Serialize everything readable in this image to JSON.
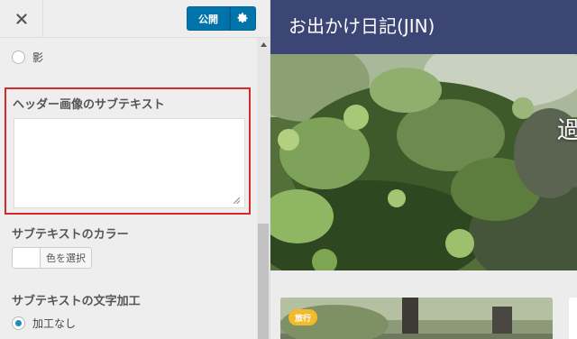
{
  "panel": {
    "publish_label": "公開",
    "shadow_option_label": "影",
    "subtext": {
      "title": "ヘッダー画像のサブテキスト",
      "value": ""
    },
    "color": {
      "title": "サブテキストのカラー",
      "button_label": "色を選択"
    },
    "decoration": {
      "title": "サブテキストの文字加工",
      "selected_option_label": "加工なし"
    },
    "icons": {
      "close": "close-icon",
      "settings": "gear-icon",
      "scroll_up": "chevron-up-icon"
    }
  },
  "preview": {
    "site_title": "お出かけ日記(JIN)",
    "header_subtext_visible": "過",
    "card": {
      "category": "旅行"
    }
  },
  "colors": {
    "accent": "#0073aa",
    "header_bar": "#3b4675",
    "highlight_border": "#d52a2a",
    "badge": "#f3ba2c"
  }
}
